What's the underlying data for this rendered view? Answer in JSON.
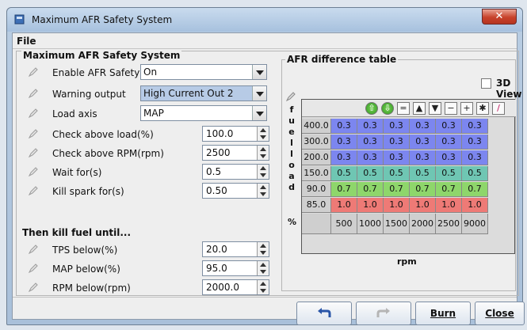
{
  "window": {
    "title": "Maximum AFR Safety System",
    "close_glyph": "✕"
  },
  "menu": {
    "file": "File"
  },
  "panel": {
    "legend": "Maximum AFR Safety System"
  },
  "settings": [
    {
      "label": "Enable AFR Safety",
      "value": "On",
      "kind": "combo"
    },
    {
      "label": "Warning output",
      "value": "High Current Out 2",
      "kind": "combo"
    },
    {
      "label": "Load axis",
      "value": "MAP",
      "kind": "combo"
    },
    {
      "label": "Check above load(%)",
      "value": "100.0",
      "kind": "spin"
    },
    {
      "label": "Check above RPM(rpm)",
      "value": "2500",
      "kind": "spin"
    },
    {
      "label": "Wait for(s)",
      "value": "0.5",
      "kind": "spin"
    },
    {
      "label": "Kill spark for(s)",
      "value": "0.50",
      "kind": "spin"
    }
  ],
  "kill_heading": "Then kill fuel until...",
  "kill_settings": [
    {
      "label": "TPS below(%)",
      "value": "20.0"
    },
    {
      "label": "MAP below(%)",
      "value": "95.0"
    },
    {
      "label": "RPM below(rpm)",
      "value": "2000.0"
    }
  ],
  "afr_table": {
    "legend": "AFR difference table",
    "view3d": "3D View",
    "y_axis_letters": [
      "f",
      "u",
      "e",
      "l",
      "l",
      "o",
      "a",
      "d"
    ],
    "percent": "%",
    "x_label": "rpm",
    "toolbar": [
      "⇧",
      "⇩",
      "=",
      "▲",
      "▼",
      "−",
      "+",
      "✱",
      "/"
    ],
    "row_labels": [
      "400.0",
      "300.0",
      "200.0",
      "150.0",
      "90.0",
      "85.0"
    ],
    "col_labels": [
      "500",
      "1000",
      "1500",
      "2000",
      "2500",
      "9000"
    ],
    "rows": [
      [
        "0.3",
        "0.3",
        "0.3",
        "0.3",
        "0.3",
        "0.3"
      ],
      [
        "0.3",
        "0.3",
        "0.3",
        "0.3",
        "0.3",
        "0.3"
      ],
      [
        "0.3",
        "0.3",
        "0.3",
        "0.3",
        "0.3",
        "0.3"
      ],
      [
        "0.5",
        "0.5",
        "0.5",
        "0.5",
        "0.5",
        "0.5"
      ],
      [
        "0.7",
        "0.7",
        "0.7",
        "0.7",
        "0.7",
        "0.7"
      ],
      [
        "1.0",
        "1.0",
        "1.0",
        "1.0",
        "1.0",
        "1.0"
      ]
    ]
  },
  "buttons": {
    "burn": "Burn",
    "close": "Close"
  },
  "colors": {
    "low": "#7c86ef",
    "mid": "#6fc6b3",
    "high": "#8ed66b",
    "max": "#ee7a76"
  }
}
